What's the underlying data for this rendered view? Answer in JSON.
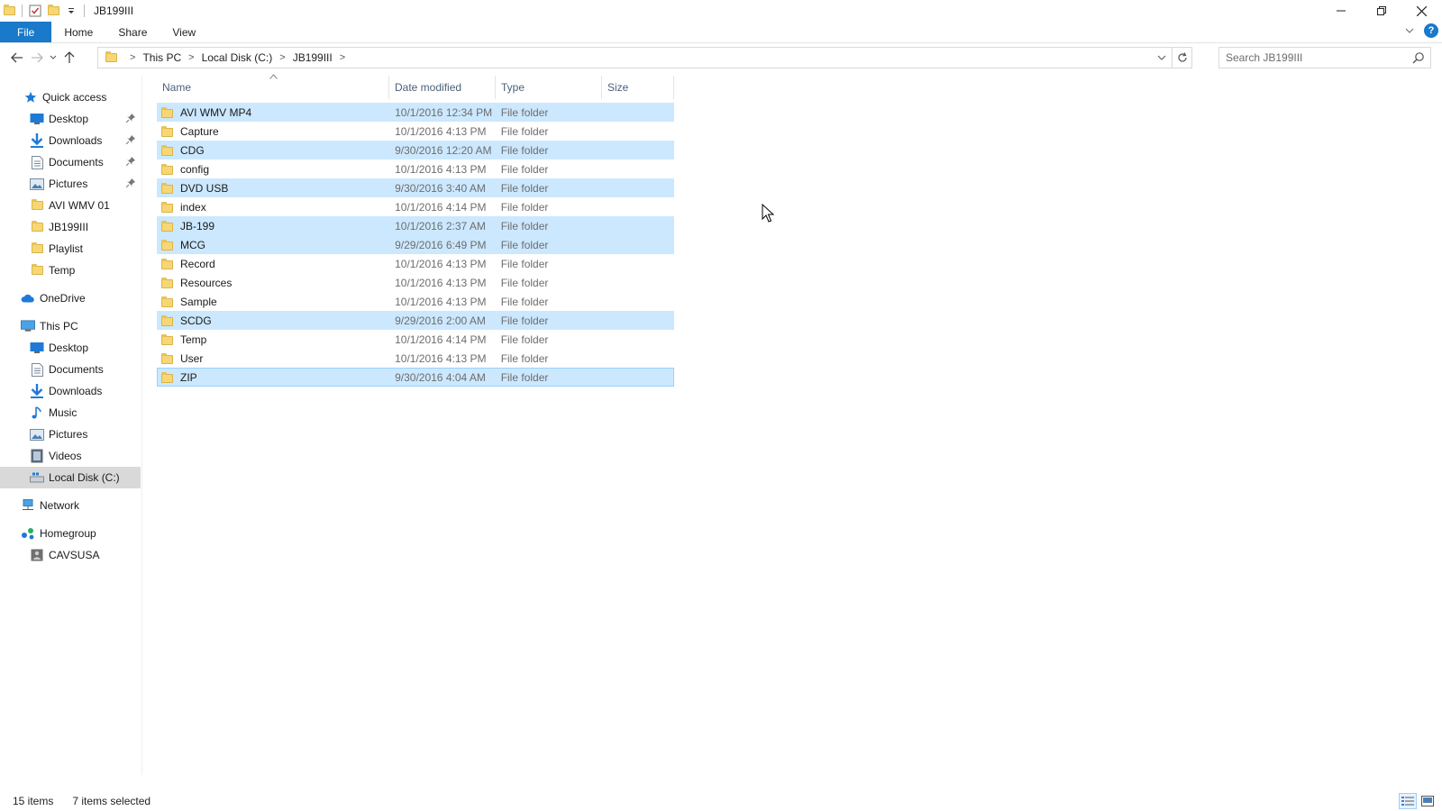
{
  "window": {
    "title": "JB199III",
    "minimize_icon": "minimize-icon",
    "restore_icon": "restore-icon",
    "close_icon": "close-icon"
  },
  "ribbon": {
    "tabs": [
      {
        "label": "File"
      },
      {
        "label": "Home"
      },
      {
        "label": "Share"
      },
      {
        "label": "View"
      }
    ]
  },
  "address_bar": {
    "crumbs": [
      "This PC",
      "Local Disk (C:)",
      "JB199III"
    ]
  },
  "search": {
    "placeholder": "Search JB199III"
  },
  "nav_pane": {
    "quick_access": "Quick access",
    "quick_items": [
      {
        "label": "Desktop",
        "pinned": true
      },
      {
        "label": "Downloads",
        "pinned": true
      },
      {
        "label": "Documents",
        "pinned": true
      },
      {
        "label": "Pictures",
        "pinned": true
      },
      {
        "label": "AVI WMV 01"
      },
      {
        "label": "JB199III"
      },
      {
        "label": "Playlist"
      },
      {
        "label": "Temp"
      }
    ],
    "onedrive": "OneDrive",
    "this_pc": "This PC",
    "pc_items": [
      {
        "label": "Desktop"
      },
      {
        "label": "Documents"
      },
      {
        "label": "Downloads"
      },
      {
        "label": "Music"
      },
      {
        "label": "Pictures"
      },
      {
        "label": "Videos"
      },
      {
        "label": "Local Disk (C:)",
        "selected": true
      }
    ],
    "network": "Network",
    "homegroup": "Homegroup",
    "homegroup_items": [
      {
        "label": "CAVSUSA"
      }
    ]
  },
  "file_list": {
    "columns": [
      "Name",
      "Date modified",
      "Type",
      "Size"
    ],
    "rows": [
      {
        "name": "AVI WMV MP4",
        "date": "10/1/2016 12:34 PM",
        "type": "File folder",
        "selected": true
      },
      {
        "name": "Capture",
        "date": "10/1/2016 4:13 PM",
        "type": "File folder",
        "selected": false
      },
      {
        "name": "CDG",
        "date": "9/30/2016 12:20 AM",
        "type": "File folder",
        "selected": true
      },
      {
        "name": "config",
        "date": "10/1/2016 4:13 PM",
        "type": "File folder",
        "selected": false
      },
      {
        "name": "DVD USB",
        "date": "9/30/2016 3:40 AM",
        "type": "File folder",
        "selected": true
      },
      {
        "name": "index",
        "date": "10/1/2016 4:14 PM",
        "type": "File folder",
        "selected": false
      },
      {
        "name": "JB-199",
        "date": "10/1/2016 2:37 AM",
        "type": "File folder",
        "selected": true
      },
      {
        "name": "MCG",
        "date": "9/29/2016 6:49 PM",
        "type": "File folder",
        "selected": true
      },
      {
        "name": "Record",
        "date": "10/1/2016 4:13 PM",
        "type": "File folder",
        "selected": false
      },
      {
        "name": "Resources",
        "date": "10/1/2016 4:13 PM",
        "type": "File folder",
        "selected": false
      },
      {
        "name": "Sample",
        "date": "10/1/2016 4:13 PM",
        "type": "File folder",
        "selected": false
      },
      {
        "name": "SCDG",
        "date": "9/29/2016 2:00 AM",
        "type": "File folder",
        "selected": true
      },
      {
        "name": "Temp",
        "date": "10/1/2016 4:14 PM",
        "type": "File folder",
        "selected": false
      },
      {
        "name": "User",
        "date": "10/1/2016 4:13 PM",
        "type": "File folder",
        "selected": false
      },
      {
        "name": "ZIP",
        "date": "9/30/2016 4:04 AM",
        "type": "File folder",
        "selected": true,
        "focused": true
      }
    ]
  },
  "status": {
    "item_count": "15 items",
    "selection": "7 items selected"
  },
  "colors": {
    "accent": "#1979ca",
    "selection": "#cce8ff",
    "folder": "#f7d774"
  }
}
